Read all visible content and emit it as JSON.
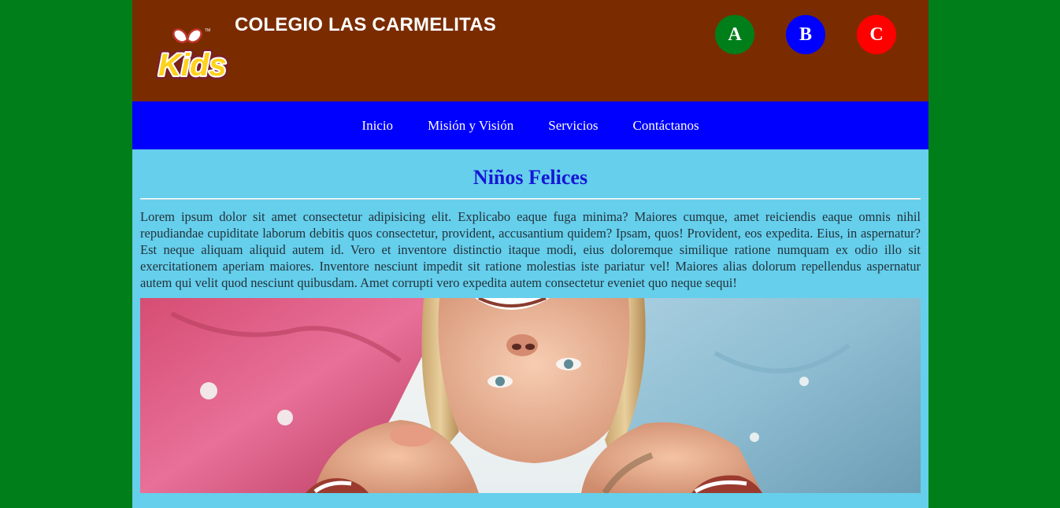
{
  "header": {
    "title": "COLEGIO LAS CARMELITAS",
    "logo_icon": "kids-logo",
    "buttons": [
      {
        "label": "A",
        "color": "#007e19"
      },
      {
        "label": "B",
        "color": "#0000ff"
      },
      {
        "label": "C",
        "color": "#ff0000"
      }
    ]
  },
  "nav": {
    "items": [
      "Inicio",
      "Misión y Visión",
      "Servicios",
      "Contáctanos"
    ]
  },
  "main": {
    "heading": "Niños Felices",
    "paragraph": "Lorem ipsum dolor sit amet consectetur adipisicing elit. Explicabo eaque fuga minima? Maiores cumque, amet reiciendis eaque omnis nihil repudiandae cupiditate laborum debitis quos consectetur, provident, accusantium quidem? Ipsam, quos! Provident, eos expedita. Eius, in aspernatur? Est neque aliquam aliquid autem id. Vero et inventore distinctio itaque modi, eius doloremque similique ratione numquam ex odio illo sit exercitationem aperiam maiores. Inventore nesciunt impedit sit ratione molestias iste pariatur vel! Maiores alias dolorum repellendus aspernatur autem qui velit quod nesciunt quibusdam. Amet corrupti vero expedita autem consectetur eveniet quo neque sequi!"
  },
  "colors": {
    "page_background": "#007e19",
    "header_background": "#7a2c00",
    "nav_background": "#0000ff",
    "content_background": "#65cfec",
    "heading": "#1616d6"
  }
}
